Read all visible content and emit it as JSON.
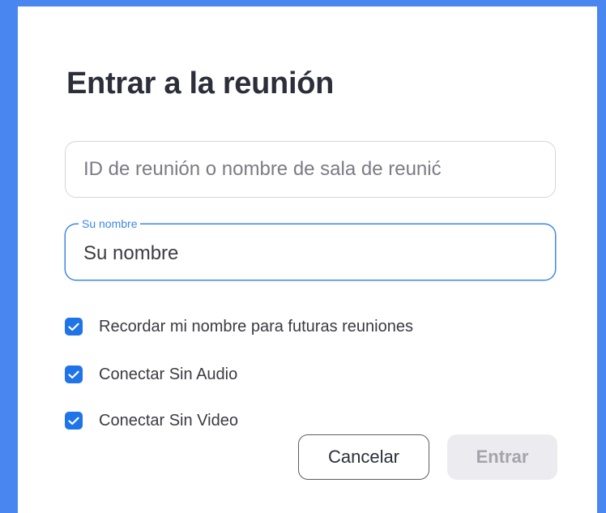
{
  "dialog": {
    "title": "Entrar a la reunión"
  },
  "meeting_id_field": {
    "placeholder": "ID de reunión o nombre de sala de reunić",
    "value": ""
  },
  "name_field": {
    "label": "Su nombre",
    "value": "Su nombre"
  },
  "options": [
    {
      "label": "Recordar mi nombre para futuras reuniones",
      "checked": true
    },
    {
      "label": "Conectar Sin Audio",
      "checked": true
    },
    {
      "label": "Conectar Sin Video",
      "checked": true
    }
  ],
  "buttons": {
    "cancel_label": "Cancelar",
    "enter_label": "Entrar"
  },
  "colors": {
    "backdrop": "#4a86f0",
    "accent": "#1f74e8",
    "focus_border": "#3d87e6",
    "disabled_button_bg": "#ececf0"
  },
  "icons": {
    "checkbox": "checkmark-icon"
  }
}
